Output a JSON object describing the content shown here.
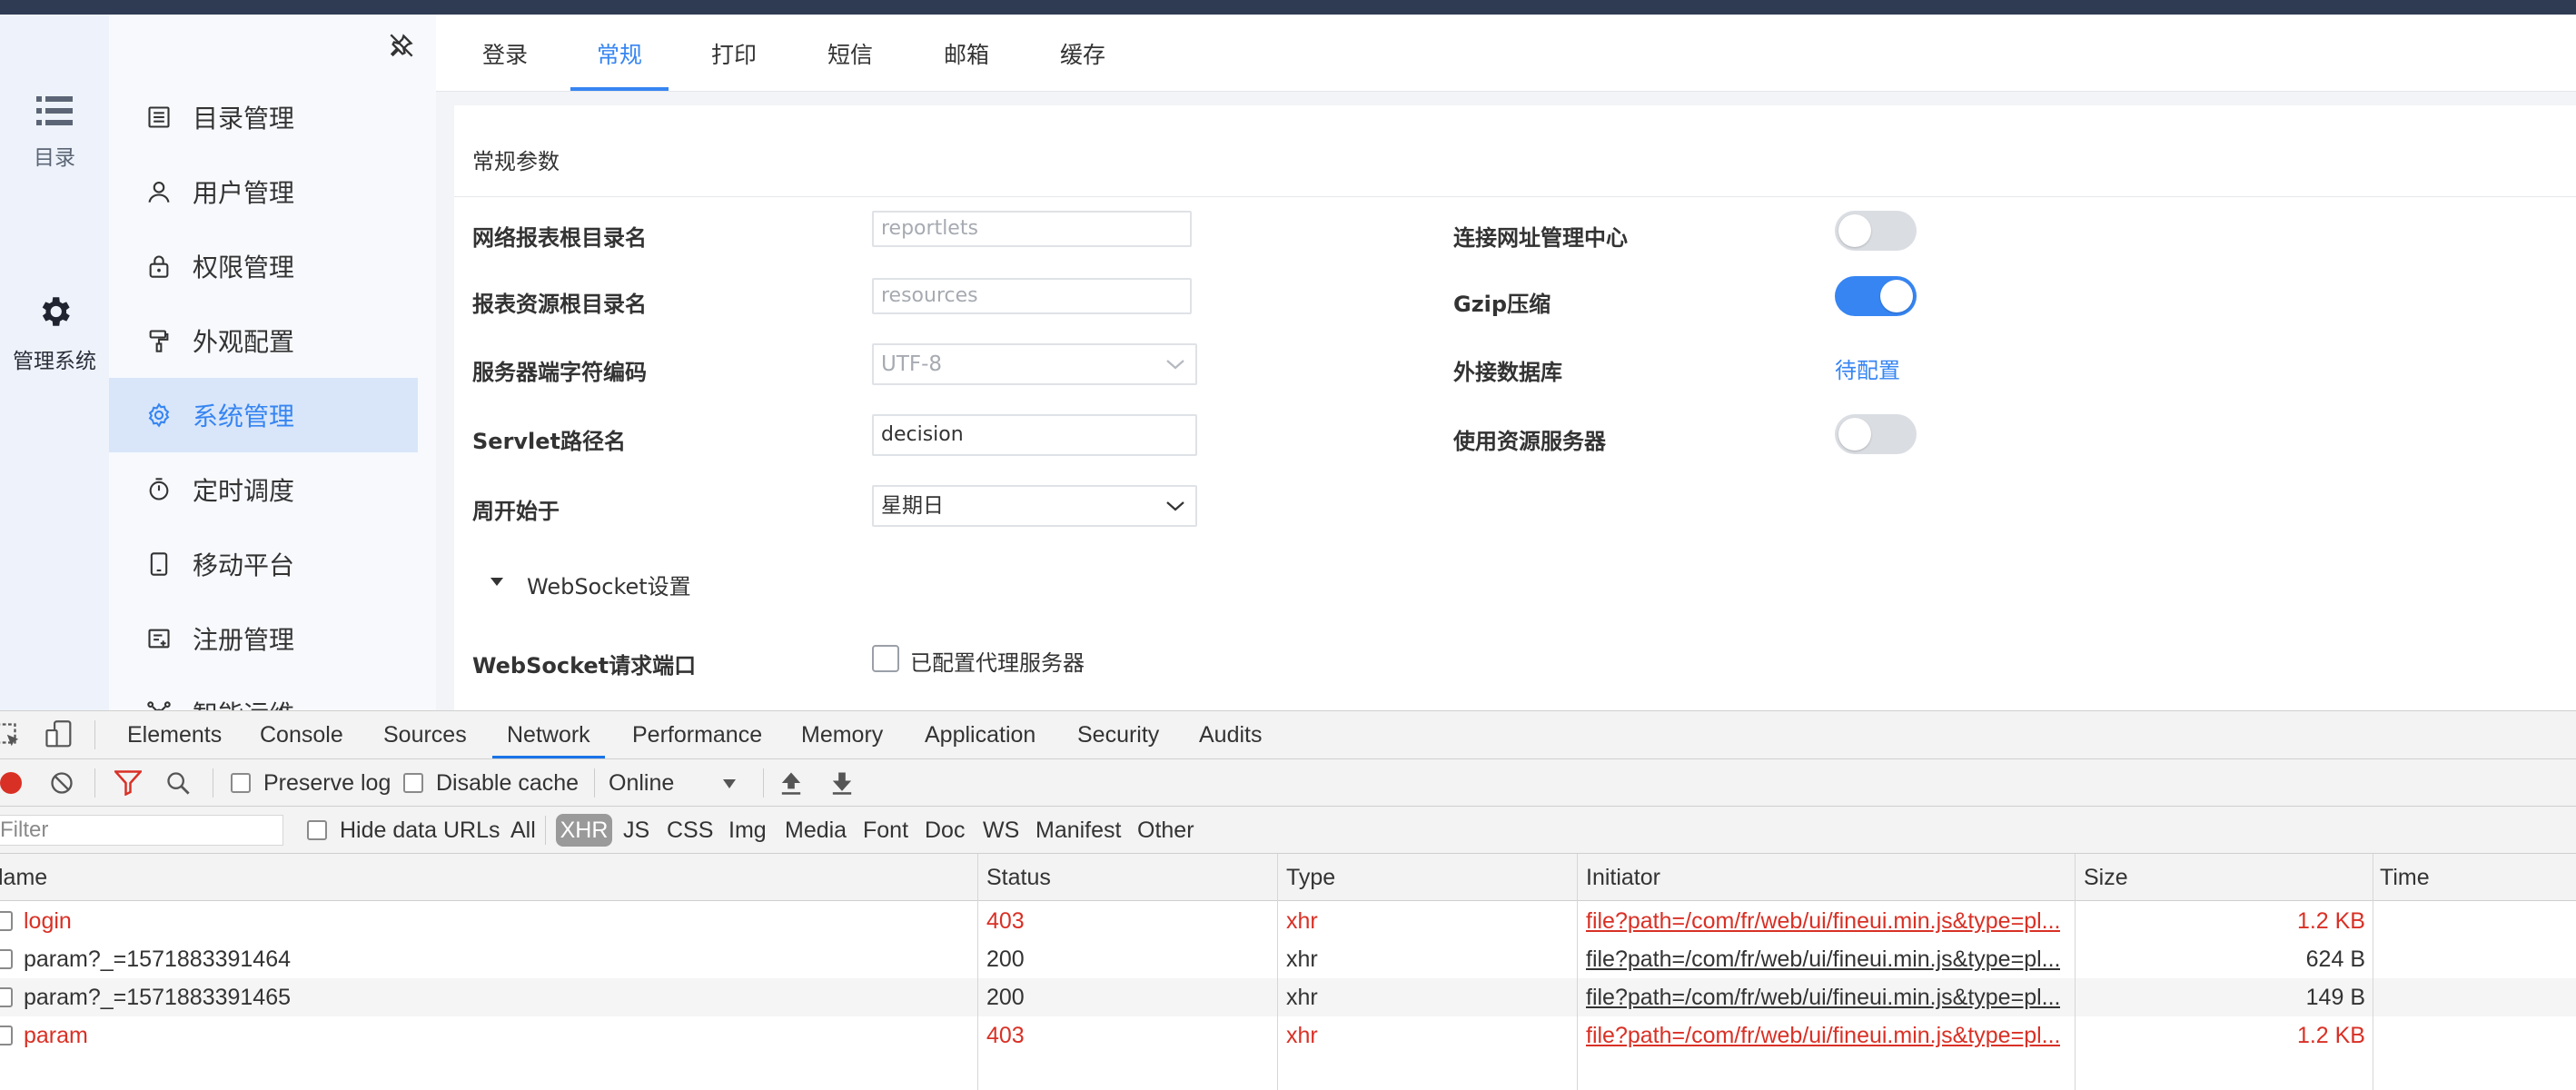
{
  "rail": {
    "items": [
      {
        "label": "目录",
        "icon": "list-icon"
      },
      {
        "label": "管理系统",
        "icon": "gear-icon"
      }
    ]
  },
  "menu": {
    "items": [
      {
        "label": "目录管理",
        "icon": "catalog-icon"
      },
      {
        "label": "用户管理",
        "icon": "user-icon"
      },
      {
        "label": "权限管理",
        "icon": "lock-icon"
      },
      {
        "label": "外观配置",
        "icon": "paint-roller-icon"
      },
      {
        "label": "系统管理",
        "icon": "settings-icon",
        "active": true
      },
      {
        "label": "定时调度",
        "icon": "timer-icon"
      },
      {
        "label": "移动平台",
        "icon": "mobile-icon"
      },
      {
        "label": "注册管理",
        "icon": "register-icon"
      },
      {
        "label": "智能运维",
        "icon": "network-icon"
      }
    ]
  },
  "tabs": [
    "登录",
    "常规",
    "打印",
    "短信",
    "邮箱",
    "缓存"
  ],
  "active_tab": "常规",
  "section_title": "常规参数",
  "form": {
    "report_root_label": "网络报表根目录名",
    "report_root_value": "reportlets",
    "resource_root_label": "报表资源根目录名",
    "resource_root_value": "resources",
    "charset_label": "服务器端字符编码",
    "charset_value": "UTF-8",
    "servlet_label": "Servlet路径名",
    "servlet_value": "decision",
    "week_start_label": "周开始于",
    "week_start_value": "星期日",
    "websocket_section": "WebSocket设置",
    "websocket_port_label": "WebSocket请求端口",
    "proxy_checkbox_label": "已配置代理服务器",
    "url_center_label": "连接网址管理中心",
    "url_center_on": false,
    "gzip_label": "Gzip压缩",
    "gzip_on": true,
    "external_db_label": "外接数据库",
    "external_db_link": "待配置",
    "resource_server_label": "使用资源服务器",
    "resource_server_on": false
  },
  "devtools": {
    "tabs": [
      "Elements",
      "Console",
      "Sources",
      "Network",
      "Performance",
      "Memory",
      "Application",
      "Security",
      "Audits"
    ],
    "active_tab": "Network",
    "toolbar": {
      "preserve_log": "Preserve log",
      "disable_cache": "Disable cache",
      "throttle": "Online"
    },
    "filter": {
      "placeholder": "Filter",
      "hide_data_urls": "Hide data URLs",
      "types": [
        "All",
        "XHR",
        "JS",
        "CSS",
        "Img",
        "Media",
        "Font",
        "Doc",
        "WS",
        "Manifest",
        "Other"
      ],
      "active_type": "XHR"
    },
    "columns": [
      "Name",
      "Status",
      "Type",
      "Initiator",
      "Size",
      "Time"
    ],
    "columns_visible": [
      "lame",
      "Status",
      "Type",
      "Initiator",
      "Size",
      "Time"
    ],
    "rows": [
      {
        "name": "login",
        "status": "403",
        "type": "xhr",
        "initiator": "file?path=/com/fr/web/ui/fineui.min.js&type=pl...",
        "size": "1.2 KB",
        "error": true
      },
      {
        "name": "param?_=1571883391464",
        "status": "200",
        "type": "xhr",
        "initiator": "file?path=/com/fr/web/ui/fineui.min.js&type=pl...",
        "size": "624 B",
        "error": false
      },
      {
        "name": "param?_=1571883391465",
        "status": "200",
        "type": "xhr",
        "initiator": "file?path=/com/fr/web/ui/fineui.min.js&type=pl...",
        "size": "149 B",
        "error": false
      },
      {
        "name": "param",
        "status": "403",
        "type": "xhr",
        "initiator": "file?path=/com/fr/web/ui/fineui.min.js&type=pl...",
        "size": "1.2 KB",
        "error": true
      }
    ]
  },
  "colors": {
    "accent": "#3685f2",
    "error": "#d93025",
    "topbar": "#2f3b52"
  }
}
